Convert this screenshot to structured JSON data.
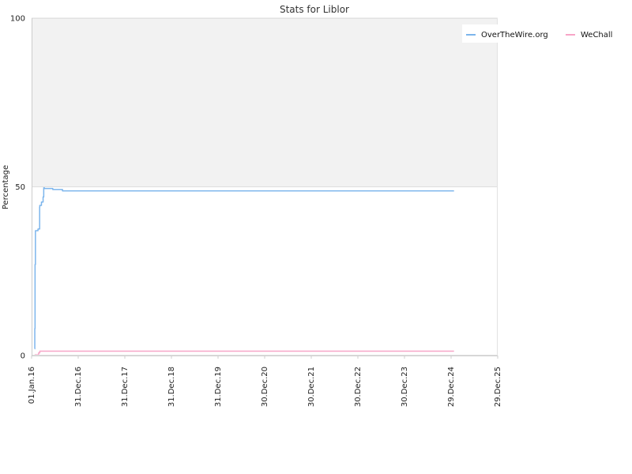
{
  "chart_data": {
    "type": "line",
    "title": "Stats for Liblor",
    "xlabel": "",
    "ylabel": "Percentage",
    "ylim": [
      0,
      100
    ],
    "y_ticks": [
      0,
      50,
      100
    ],
    "x_ticks": [
      "01.Jan.16",
      "31.Dec.16",
      "31.Dec.17",
      "31.Dec.18",
      "31.Dec.19",
      "30.Dec.20",
      "30.Dec.21",
      "30.Dec.22",
      "30.Dec.23",
      "29.Dec.24",
      "29.Dec.25"
    ],
    "x_range": [
      "2016-01-01",
      "2025-12-29"
    ],
    "grid": true,
    "upper_band_color": "#f2f2f2",
    "legend_position": "top-right",
    "series": [
      {
        "name": "OverTheWire.org",
        "color": "#7cb5ec",
        "x": [
          "2016-01-25",
          "2016-01-26",
          "2016-01-28",
          "2016-01-31",
          "2016-02-02",
          "2016-02-20",
          "2016-03-04",
          "2016-03-05",
          "2016-03-18",
          "2016-03-31",
          "2016-04-05",
          "2016-04-10",
          "2016-06-15",
          "2016-08-30",
          "2025-01-21"
        ],
        "values": [
          2,
          8,
          27,
          37,
          37,
          37.5,
          44,
          44.5,
          45.5,
          47,
          49.7,
          49.5,
          49.2,
          48.8,
          48.8
        ]
      },
      {
        "name": "WeChall",
        "color": "#f7a5c7",
        "x": [
          "2016-01-25",
          "2016-02-20",
          "2016-02-25",
          "2016-03-04",
          "2016-03-05",
          "2025-01-21"
        ],
        "values": [
          0.2,
          0.2,
          0.8,
          0.8,
          1.3,
          1.3
        ]
      }
    ]
  }
}
